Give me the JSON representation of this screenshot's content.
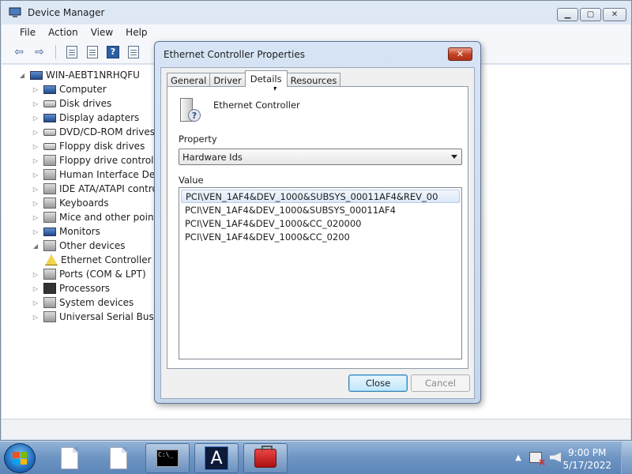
{
  "device_manager": {
    "title": "Device Manager",
    "menu": [
      "File",
      "Action",
      "View",
      "Help"
    ],
    "tree": {
      "root": "WIN-AEBT1NRHQFU",
      "items": [
        {
          "label": "Computer",
          "icon": "computer-icon"
        },
        {
          "label": "Disk drives",
          "icon": "disk-drive-icon"
        },
        {
          "label": "Display adapters",
          "icon": "display-adapter-icon"
        },
        {
          "label": "DVD/CD-ROM drives",
          "icon": "dvd-drive-icon"
        },
        {
          "label": "Floppy disk drives",
          "icon": "floppy-disk-icon"
        },
        {
          "label": "Floppy drive controllers",
          "icon": "floppy-controller-icon"
        },
        {
          "label": "Human Interface Devices",
          "icon": "hid-icon"
        },
        {
          "label": "IDE ATA/ATAPI controllers",
          "icon": "ide-controller-icon"
        },
        {
          "label": "Keyboards",
          "icon": "keyboard-icon"
        },
        {
          "label": "Mice and other pointing devices",
          "icon": "mouse-icon"
        },
        {
          "label": "Monitors",
          "icon": "monitor-icon"
        },
        {
          "label": "Other devices",
          "icon": "other-devices-icon",
          "expanded": true
        },
        {
          "label": "Ethernet Controller",
          "icon": "warning-device-icon",
          "child": true
        },
        {
          "label": "Ports (COM & LPT)",
          "icon": "port-icon"
        },
        {
          "label": "Processors",
          "icon": "processor-icon"
        },
        {
          "label": "System devices",
          "icon": "system-device-icon"
        },
        {
          "label": "Universal Serial Bus controllers",
          "icon": "usb-icon"
        }
      ]
    }
  },
  "dialog": {
    "title": "Ethernet Controller Properties",
    "tabs": [
      "General",
      "Driver",
      "Details",
      "Resources"
    ],
    "active_tab": "Details",
    "device_name": "Ethernet Controller",
    "property_label": "Property",
    "property_value": "Hardware Ids",
    "value_label": "Value",
    "values": [
      "PCI\\VEN_1AF4&DEV_1000&SUBSYS_00011AF4&REV_00",
      "PCI\\VEN_1AF4&DEV_1000&SUBSYS_00011AF4",
      "PCI\\VEN_1AF4&DEV_1000&CC_020000",
      "PCI\\VEN_1AF4&DEV_1000&CC_0200"
    ],
    "close_button": "Close",
    "cancel_button": "Cancel"
  },
  "taskbar": {
    "time": "9:00 PM",
    "date": "5/17/2022"
  }
}
